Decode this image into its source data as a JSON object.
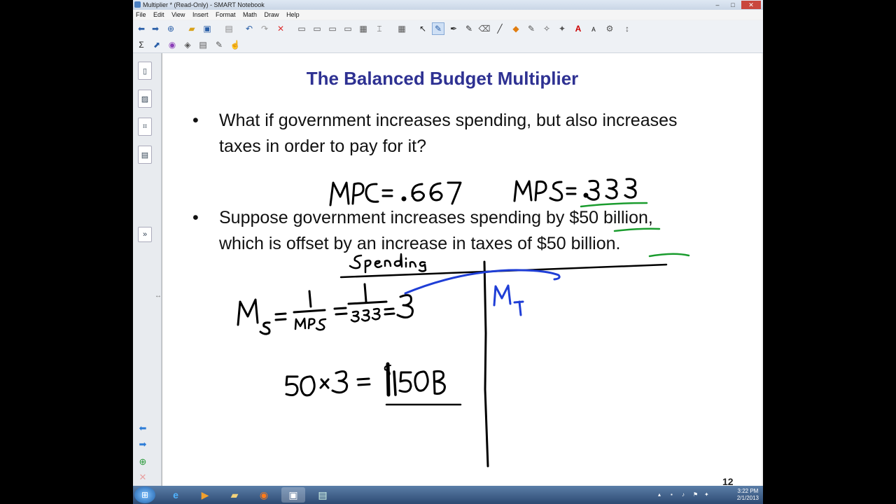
{
  "window": {
    "title": "Multiplier * (Read-Only) - SMART Notebook",
    "min": "–",
    "max": "□",
    "close": "✕"
  },
  "menu": [
    "File",
    "Edit",
    "View",
    "Insert",
    "Format",
    "Math",
    "Draw",
    "Help"
  ],
  "toolbar1_icons": [
    "back-icon",
    "forward-icon",
    "add-page-icon",
    "open-icon",
    "save-icon",
    "paste-icon",
    "undo-icon",
    "redo-icon",
    "delete-icon",
    "screen-shade-icon",
    "full-screen-icon",
    "dual-display-icon",
    "document-camera-icon",
    "capture-icon",
    "table-icon",
    "select-icon",
    "pen-icon",
    "creative-pen-icon",
    "magic-pen-icon",
    "eraser-icon",
    "line-icon",
    "shape-icon",
    "fill-icon",
    "properties-icon",
    "text-icon",
    "font-icon",
    "more-icon"
  ],
  "toolbar2_icons": [
    "sigma-icon",
    "shapes-icon",
    "3d-icon",
    "gallery-icon",
    "math-tools-icon",
    "edit-icon",
    "pointer-icon"
  ],
  "slide": {
    "title": "The Balanced Budget Multiplier",
    "bullet_char": "•",
    "bullet1": "What if government increases spending, but also increases taxes in order to pay for it?",
    "bullet2": "Suppose government increases spending by $50 billion, which is offset by an increase in taxes of $50 billion.",
    "page_number": "12"
  },
  "handwriting": {
    "mpc": "MPC = .667",
    "mps": "MPS = .333",
    "spending": "Spending",
    "ms": "Ms = 1/MPS = 1/.333 = 3",
    "mt": "MT",
    "calc": "50 × 3 = $150B"
  },
  "taskbar": {
    "time": "3:22 PM",
    "date": "2/1/2013"
  },
  "colors": {
    "title": "#2e3192",
    "ink_black": "#000000",
    "ink_green": "#1a9c2e",
    "ink_blue": "#1f3ed6"
  }
}
